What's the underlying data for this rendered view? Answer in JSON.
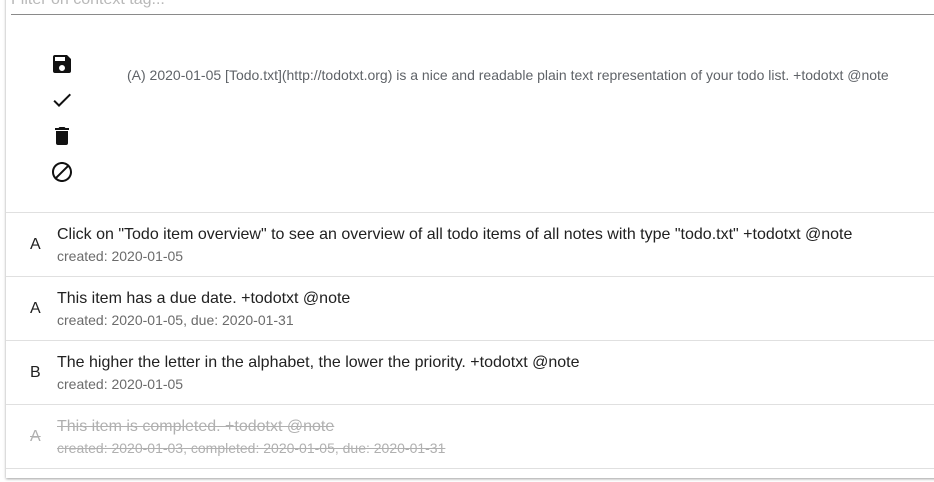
{
  "filter": {
    "placeholder": "Filter on context tag...",
    "value": ""
  },
  "editor": {
    "text": "(A) 2020-01-05 [Todo.txt](http://todotxt.org) is a nice and readable plain text representation of your todo list. +todotxt @note",
    "actions": [
      {
        "icon": "save-icon"
      },
      {
        "icon": "check-icon"
      },
      {
        "icon": "delete-icon"
      },
      {
        "icon": "cancel-icon"
      }
    ]
  },
  "todos": [
    {
      "priority": "A",
      "text": "Click on \"Todo item overview\" to see an overview of all todo items of all notes with type \"todo.txt\" +todotxt @note",
      "meta": "created: 2020-01-05",
      "completed": false
    },
    {
      "priority": "A",
      "text": "This item has a due date. +todotxt @note",
      "meta": "created: 2020-01-05, due: 2020-01-31",
      "completed": false
    },
    {
      "priority": "B",
      "text": "The higher the letter in the alphabet, the lower the priority. +todotxt @note",
      "meta": "created: 2020-01-05",
      "completed": false
    },
    {
      "priority": "A",
      "text": "This item is completed. +todotxt @note",
      "meta": "created: 2020-01-03, completed: 2020-01-05, due: 2020-01-31",
      "completed": true
    }
  ],
  "colors": {
    "text": "#212121",
    "secondary": "#6b6b6b",
    "completed": "#b0b0b0",
    "divider": "#e0e0e0"
  }
}
